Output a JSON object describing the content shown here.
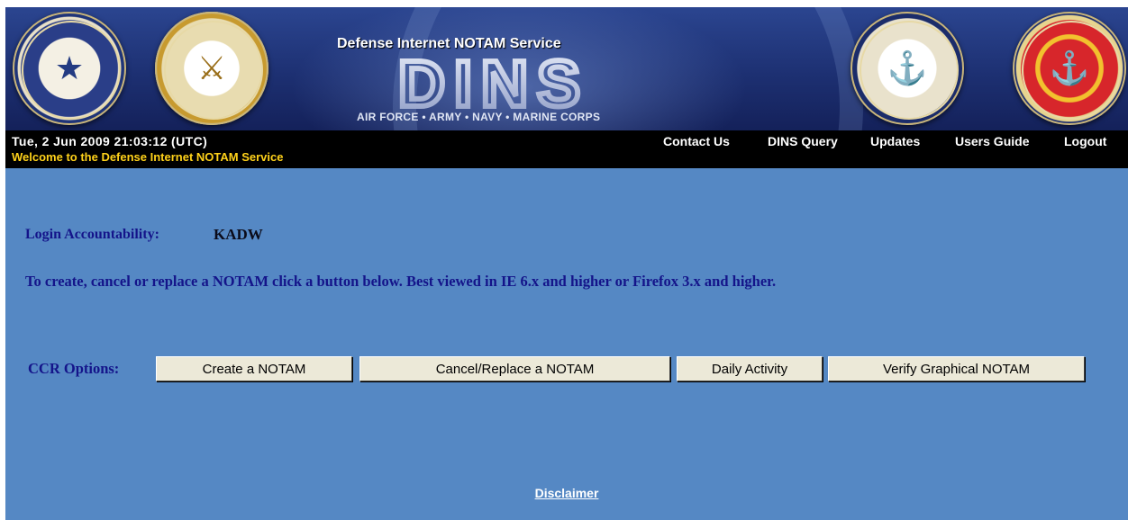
{
  "banner": {
    "title": "Defense Internet NOTAM Service",
    "logo_text": "DINS",
    "branches": "AIR FORCE • ARMY • NAVY • MARINE CORPS",
    "seals": [
      {
        "name": "air-force-seal-icon",
        "glyph": "★"
      },
      {
        "name": "army-seal-icon",
        "glyph": "⚔"
      },
      {
        "name": "navy-seal-icon",
        "glyph": "⚓"
      },
      {
        "name": "marine-corps-seal-icon",
        "glyph": "⚓"
      }
    ],
    "colors": {
      "banner": "#1d3072",
      "logo": "#c8d0e8"
    }
  },
  "topbar": {
    "datetime": "Tue, 2 Jun 2009 21:03:12 (UTC)",
    "welcome": "Welcome to the Defense Internet NOTAM Service",
    "nav": [
      "Contact Us",
      "DINS Query",
      "Updates",
      "Users Guide",
      "Logout"
    ],
    "colors": {
      "background": "#000000",
      "welcome": "#ffd21a"
    }
  },
  "content": {
    "login_label": "Login Accountability:",
    "login_value": "KADW",
    "instructions": "To create, cancel or replace a NOTAM click a button below. Best viewed in IE 6.x and higher or Firefox 3.x and higher.",
    "ccr_label": "CCR Options:",
    "buttons": [
      "Create a NOTAM",
      "Cancel/Replace a NOTAM",
      "Daily Activity",
      "Verify Graphical NOTAM"
    ],
    "colors": {
      "background": "#5588c4",
      "text": "#14148a"
    }
  },
  "footer": {
    "disclaimer": "Disclaimer"
  }
}
